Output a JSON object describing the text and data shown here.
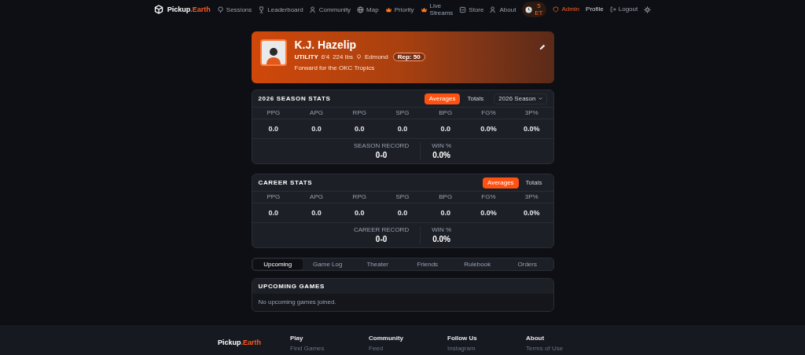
{
  "nav": {
    "brand": {
      "first": "Pickup",
      "second": ".Earth"
    },
    "items": [
      {
        "label": "Sessions",
        "accent": false
      },
      {
        "label": "Leaderboard",
        "accent": false
      },
      {
        "label": "Community",
        "accent": false
      },
      {
        "label": "Map",
        "accent": false
      },
      {
        "label": "Priority",
        "accent": true
      },
      {
        "label": "Live Streams",
        "accent": true
      },
      {
        "label": "Store",
        "accent": false
      },
      {
        "label": "About",
        "accent": false
      }
    ],
    "credits": "5 ET",
    "admin": "Admin",
    "profile": "Profile",
    "logout": "Logout"
  },
  "profile": {
    "name": "K.J. Hazelip",
    "position": "UTILITY",
    "height": "6'4",
    "weight": "224 lbs",
    "city": "Edmond",
    "rep": "Rep: 50",
    "bio": "Forward for the OKC Tropics"
  },
  "season_stats": {
    "title": "2026 SEASON STATS",
    "toggles": [
      {
        "label": "Averages",
        "selected": true
      },
      {
        "label": "Totals",
        "selected": false
      }
    ],
    "season_select": "2026 Season",
    "stats": [
      {
        "label": "PPG",
        "value": "0.0"
      },
      {
        "label": "APG",
        "value": "0.0"
      },
      {
        "label": "RPG",
        "value": "0.0"
      },
      {
        "label": "SPG",
        "value": "0.0"
      },
      {
        "label": "BPG",
        "value": "0.0"
      },
      {
        "label": "FG%",
        "value": "0.0%"
      },
      {
        "label": "3P%",
        "value": "0.0%"
      }
    ],
    "record": {
      "label": "SEASON RECORD",
      "value": "0-0"
    },
    "win": {
      "label": "WIN %",
      "value": "0.0%"
    }
  },
  "career_stats": {
    "title": "CAREER STATS",
    "toggles": [
      {
        "label": "Averages",
        "selected": true
      },
      {
        "label": "Totals",
        "selected": false
      }
    ],
    "stats": [
      {
        "label": "PPG",
        "value": "0.0"
      },
      {
        "label": "APG",
        "value": "0.0"
      },
      {
        "label": "RPG",
        "value": "0.0"
      },
      {
        "label": "SPG",
        "value": "0.0"
      },
      {
        "label": "BPG",
        "value": "0.0"
      },
      {
        "label": "FG%",
        "value": "0.0%"
      },
      {
        "label": "3P%",
        "value": "0.0%"
      }
    ],
    "record": {
      "label": "CAREER RECORD",
      "value": "0-0"
    },
    "win": {
      "label": "WIN %",
      "value": "0.0%"
    }
  },
  "tabs": [
    {
      "label": "Upcoming",
      "selected": true
    },
    {
      "label": "Game Log",
      "selected": false
    },
    {
      "label": "Theater",
      "selected": false
    },
    {
      "label": "Friends",
      "selected": false
    },
    {
      "label": "Rulebook",
      "selected": false
    },
    {
      "label": "Orders",
      "selected": false
    }
  ],
  "upcoming": {
    "title": "UPCOMING GAMES",
    "empty": "No upcoming games joined."
  },
  "footer": {
    "brand": {
      "first": "Pickup",
      "second": ".Earth"
    },
    "columns": [
      {
        "heading": "Play",
        "link": "Find Games"
      },
      {
        "heading": "Community",
        "link": "Feed"
      },
      {
        "heading": "Follow Us",
        "link": "Instagram"
      },
      {
        "heading": "About",
        "link": "Terms of Use"
      }
    ]
  }
}
